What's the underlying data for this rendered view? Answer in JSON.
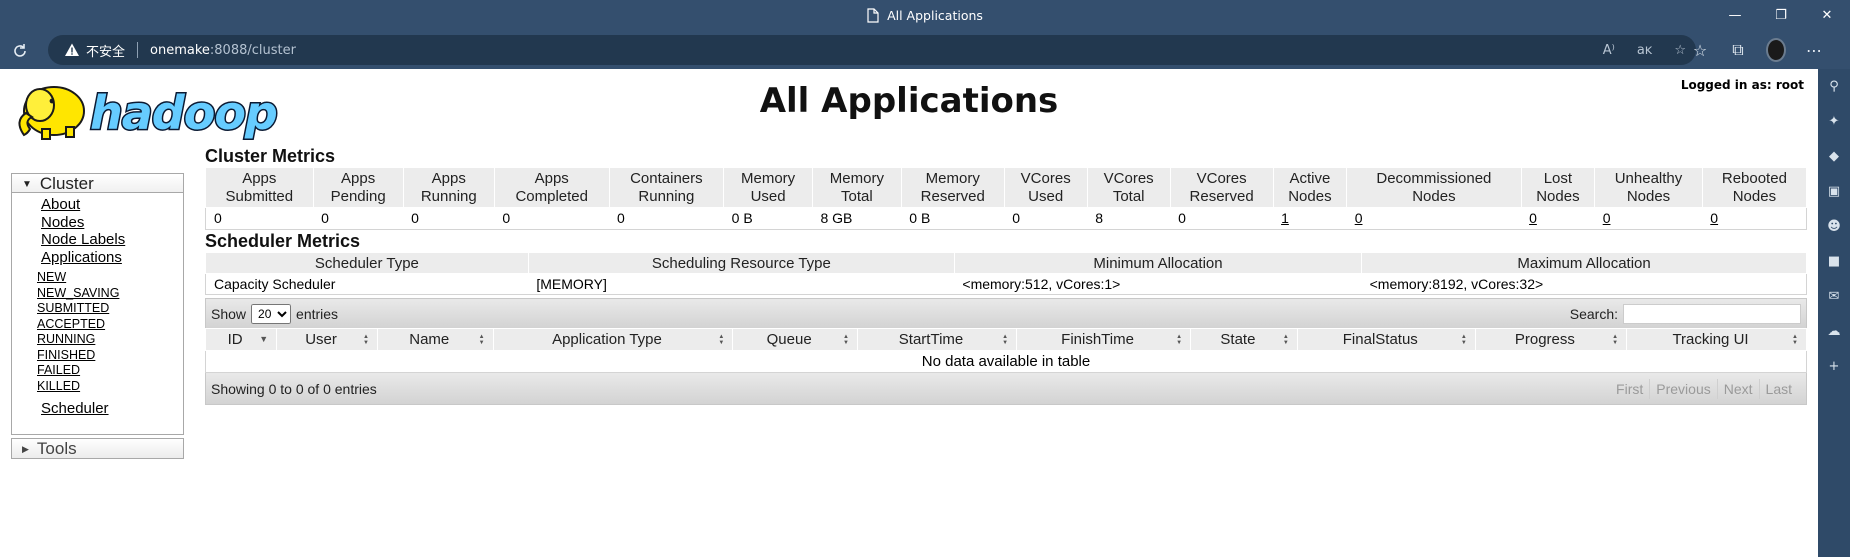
{
  "browser": {
    "tab_title": "All Applications",
    "insecure_label": "不安全",
    "url_host": "onemake",
    "url_rest": ":8088/cluster",
    "window_controls": [
      "minimize-icon",
      "restore-icon",
      "close-icon"
    ],
    "url_right_icons": [
      "read-aloud-icon",
      "translate-icon",
      "add-favorite-icon"
    ],
    "toolbar_icons": [
      "favorites-icon",
      "collections-icon",
      "profile-avatar",
      "more-icon"
    ],
    "sidebar_icons": [
      "search-icon",
      "sparkle-icon",
      "tag-icon",
      "briefcase-icon",
      "people-icon",
      "office-icon",
      "outlook-icon",
      "cloud-icon",
      "plus-icon"
    ]
  },
  "header": {
    "title": "All Applications",
    "logged_in": "Logged in as: root",
    "logo_text": "hadoop"
  },
  "nav": {
    "cluster_label": "Cluster",
    "links": [
      "About",
      "Nodes",
      "Node Labels",
      "Applications"
    ],
    "app_states": [
      "NEW",
      "NEW_SAVING",
      "SUBMITTED",
      "ACCEPTED",
      "RUNNING",
      "FINISHED",
      "FAILED",
      "KILLED"
    ],
    "scheduler_label": "Scheduler",
    "tools_label": "Tools"
  },
  "cluster_metrics": {
    "title": "Cluster Metrics",
    "headers": [
      [
        "Apps",
        "Submitted"
      ],
      [
        "Apps",
        "Pending"
      ],
      [
        "Apps",
        "Running"
      ],
      [
        "Apps",
        "Completed"
      ],
      [
        "Containers",
        "Running"
      ],
      [
        "Memory",
        "Used"
      ],
      [
        "Memory",
        "Total"
      ],
      [
        "Memory",
        "Reserved"
      ],
      [
        "VCores",
        "Used"
      ],
      [
        "VCores",
        "Total"
      ],
      [
        "VCores",
        "Reserved"
      ],
      [
        "Active",
        "Nodes"
      ],
      [
        "Decommissioned",
        "Nodes"
      ],
      [
        "Lost",
        "Nodes"
      ],
      [
        "Unhealthy",
        "Nodes"
      ],
      [
        "Rebooted",
        "Nodes"
      ]
    ],
    "values": [
      "0",
      "0",
      "0",
      "0",
      "0",
      "0 B",
      "8 GB",
      "0 B",
      "0",
      "8",
      "0",
      "1",
      "0",
      "0",
      "0",
      "0"
    ],
    "linked_columns": [
      11,
      12,
      13,
      14,
      15
    ]
  },
  "scheduler_metrics": {
    "title": "Scheduler Metrics",
    "headers": [
      "Scheduler Type",
      "Scheduling Resource Type",
      "Minimum Allocation",
      "Maximum Allocation"
    ],
    "values": [
      "Capacity Scheduler",
      "[MEMORY]",
      "<memory:512, vCores:1>",
      "<memory:8192, vCores:32>"
    ]
  },
  "apps_table": {
    "show_label": "Show",
    "entries_label": "entries",
    "page_size": "20",
    "page_size_options": [
      "20"
    ],
    "search_label": "Search:",
    "search_value": "",
    "columns": [
      "ID",
      "User",
      "Name",
      "Application Type",
      "Queue",
      "StartTime",
      "FinishTime",
      "State",
      "FinalStatus",
      "Progress",
      "Tracking UI"
    ],
    "empty_message": "No data available in table",
    "info": "Showing 0 to 0 of 0 entries",
    "pagination": [
      "First",
      "Previous",
      "Next",
      "Last"
    ]
  }
}
